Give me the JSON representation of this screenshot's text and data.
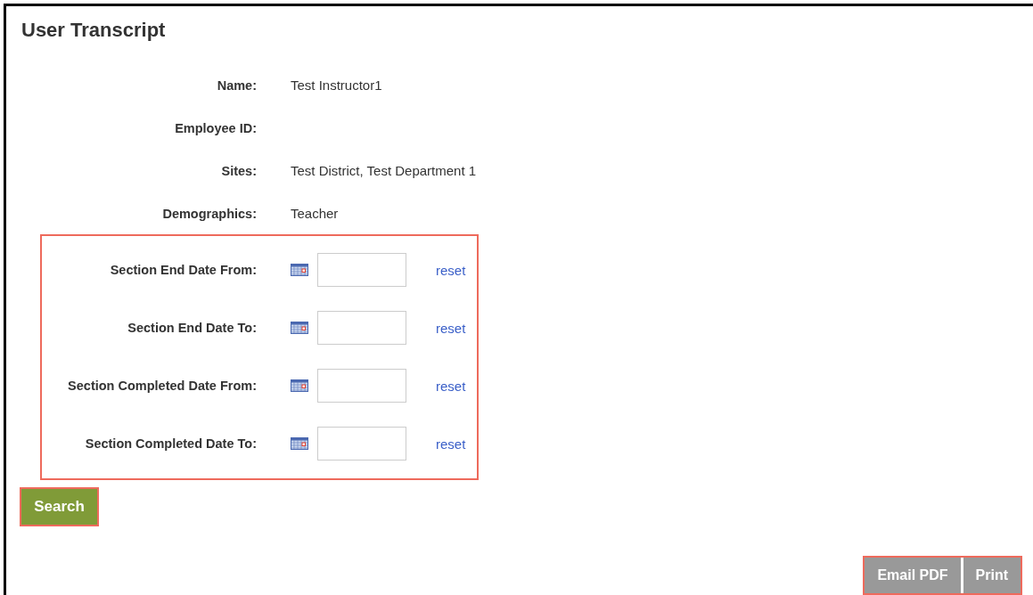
{
  "page": {
    "title": "User Transcript"
  },
  "info_fields": [
    {
      "label": "Name:",
      "value": "Test Instructor1"
    },
    {
      "label": "Employee ID:"
    },
    {
      "label": "Sites:",
      "value": "Test District, Test Department 1"
    },
    {
      "label": "Demographics:",
      "value": "Teacher"
    }
  ],
  "date_filters": [
    {
      "label": "Section End Date From:",
      "reset": "reset"
    },
    {
      "label": "Section End Date To:",
      "reset": "reset"
    },
    {
      "label": "Section Completed Date From:",
      "reset": "reset"
    },
    {
      "label": "Section Completed Date To:",
      "reset": "reset"
    }
  ],
  "search_button": "Search",
  "actions": [
    "Email PDF",
    "Print"
  ]
}
